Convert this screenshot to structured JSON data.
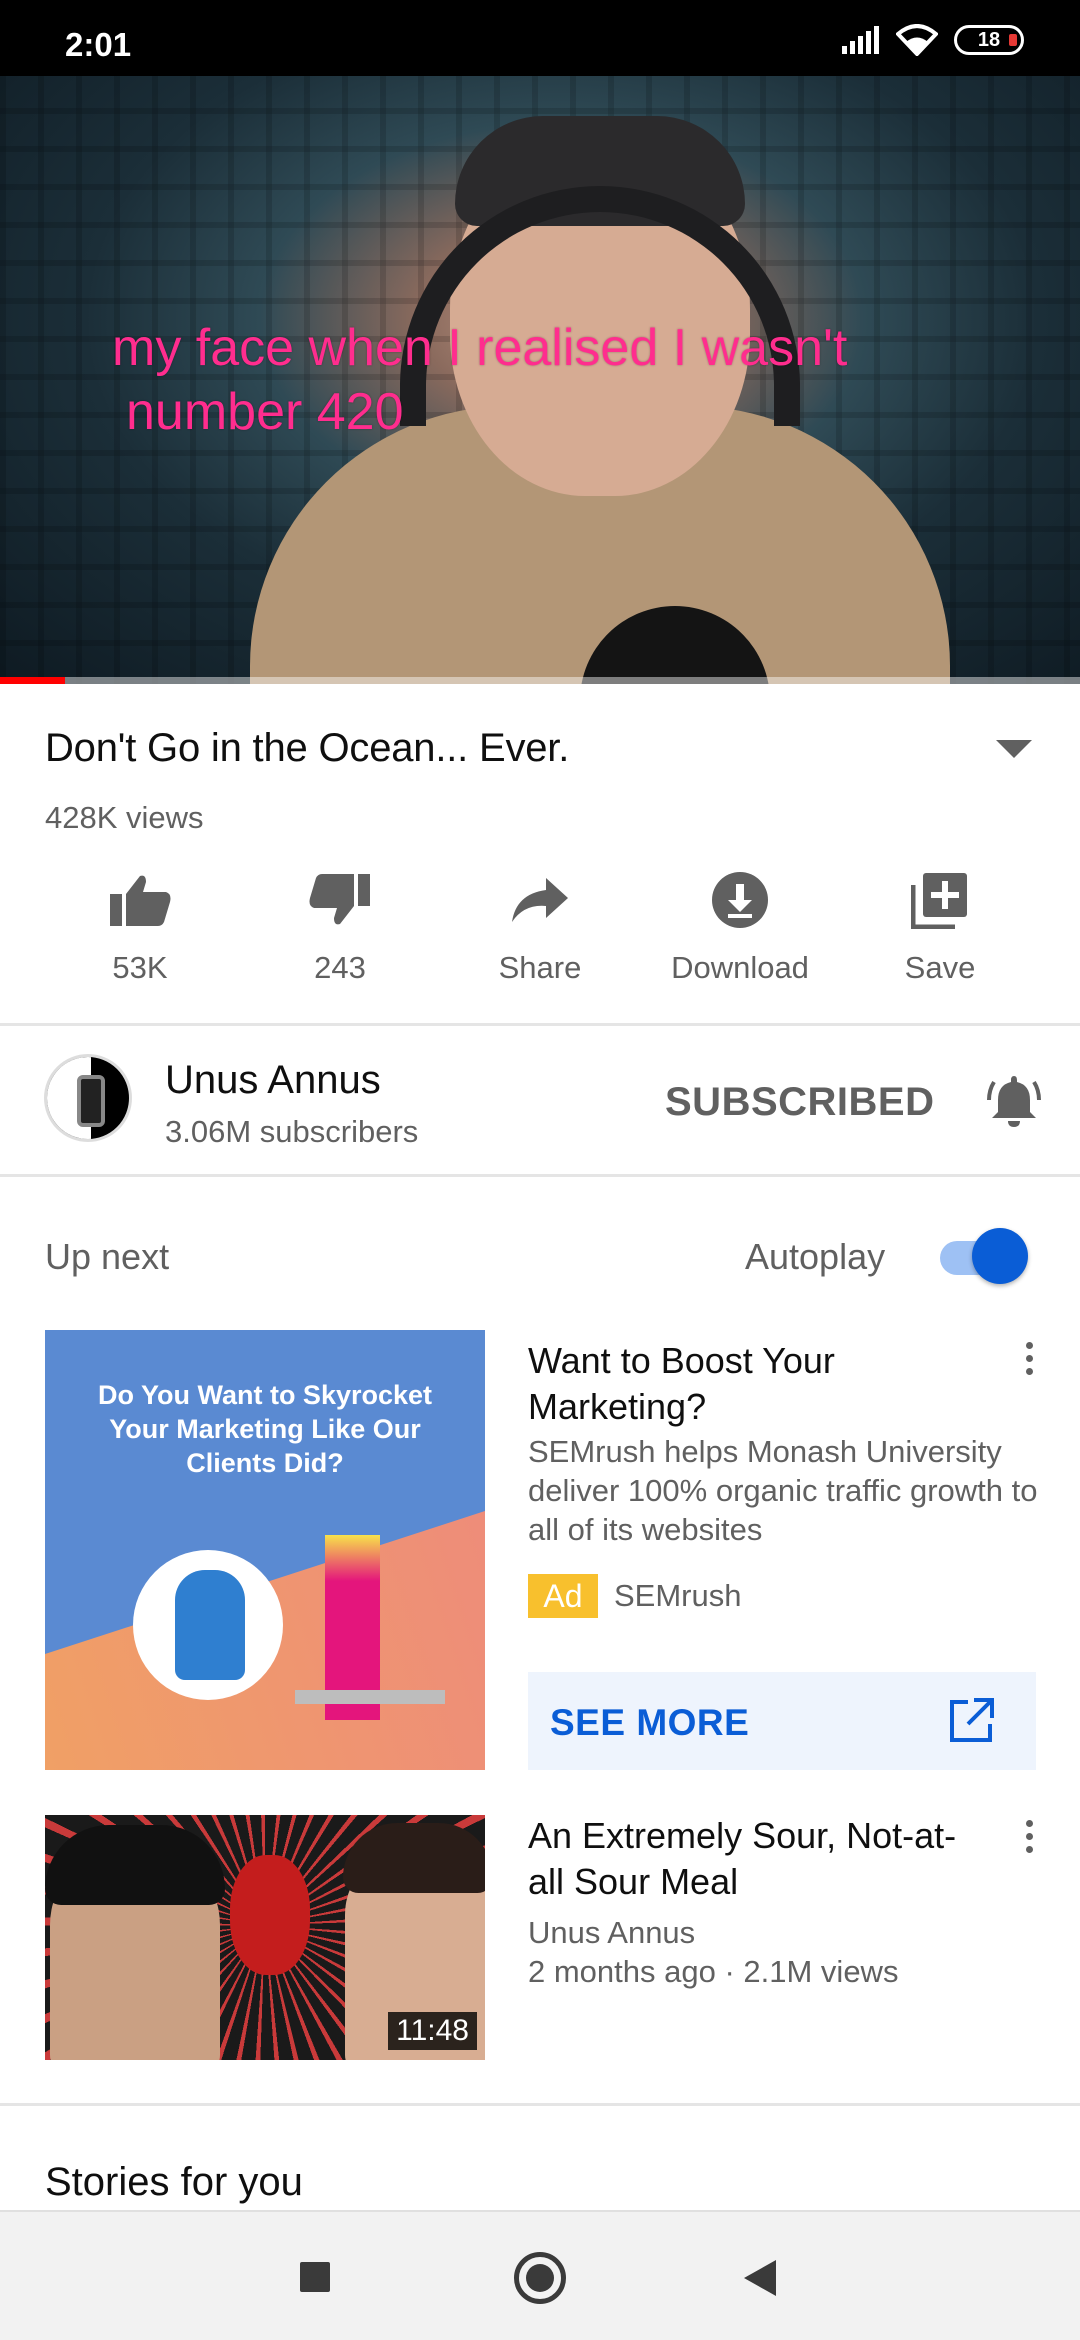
{
  "status_bar": {
    "time": "2:01",
    "battery": "18"
  },
  "player": {
    "caption_line1": "my face when I realised I wasn't",
    "caption_line2": "number 420",
    "progress_fraction": 0.06
  },
  "video": {
    "title": "Don't Go in the Ocean... Ever.",
    "views": "428K views"
  },
  "actions": [
    {
      "label": "53K",
      "icon": "thumb-up-icon"
    },
    {
      "label": "243",
      "icon": "thumb-down-icon"
    },
    {
      "label": "Share",
      "icon": "share-icon"
    },
    {
      "label": "Download",
      "icon": "download-icon"
    },
    {
      "label": "Save",
      "icon": "playlist-add-icon"
    }
  ],
  "channel": {
    "name": "Unus Annus",
    "subscribers": "3.06M subscribers",
    "subscribe_label": "SUBSCRIBED"
  },
  "up_next": {
    "label": "Up next",
    "autoplay_label": "Autoplay",
    "autoplay_on": true
  },
  "ad": {
    "thumbnail_text": "Do You Want to Skyrocket Your Marketing Like Our Clients Did?",
    "title": "Want to Boost Your Marketing?",
    "description": "SEMrush helps Monash University deliver 100% organic traffic growth to all of its websites",
    "badge": "Ad",
    "advertiser": "SEMrush",
    "cta": "SEE MORE"
  },
  "next_video": {
    "title": "An Extremely Sour, Not-at-all Sour Meal",
    "channel": "Unus Annus",
    "meta": "2 months ago · 2.1M views",
    "duration": "11:48"
  },
  "stories": {
    "title": "Stories for you"
  },
  "colors": {
    "accent": "#0a5dd6",
    "progress": "#ff0000",
    "caption": "#ff2d8e",
    "ad_badge": "#f8c02d"
  }
}
